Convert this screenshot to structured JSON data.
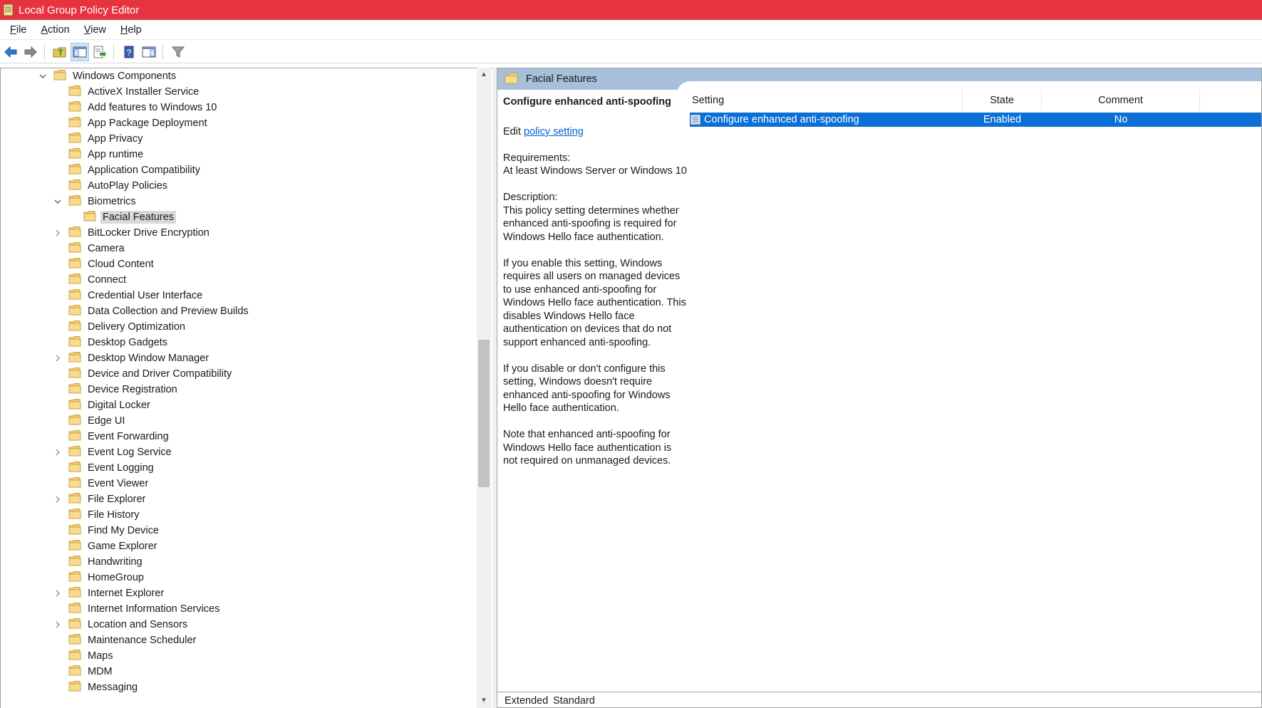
{
  "window": {
    "title": "Local Group Policy Editor",
    "accent": "#e5333f"
  },
  "menu": [
    {
      "label": "File",
      "mnemonic": "F",
      "rest": "ile"
    },
    {
      "label": "Action",
      "mnemonic": "A",
      "rest": "ction"
    },
    {
      "label": "View",
      "mnemonic": "V",
      "rest": "iew"
    },
    {
      "label": "Help",
      "mnemonic": "H",
      "rest": "elp"
    }
  ],
  "toolbar": {
    "icons": [
      "back-arrow-icon",
      "forward-arrow-icon",
      "up-folder-icon",
      "show-hide-tree-icon",
      "export-list-icon",
      "help-icon",
      "show-hide-action-pane-icon",
      "filter-icon"
    ]
  },
  "tree": [
    {
      "label": "Windows Components",
      "level": 0,
      "expander": "open"
    },
    {
      "label": "ActiveX Installer Service",
      "level": 1,
      "expander": "none"
    },
    {
      "label": "Add features to Windows 10",
      "level": 1,
      "expander": "none"
    },
    {
      "label": "App Package Deployment",
      "level": 1,
      "expander": "none"
    },
    {
      "label": "App Privacy",
      "level": 1,
      "expander": "none"
    },
    {
      "label": "App runtime",
      "level": 1,
      "expander": "none"
    },
    {
      "label": "Application Compatibility",
      "level": 1,
      "expander": "none"
    },
    {
      "label": "AutoPlay Policies",
      "level": 1,
      "expander": "none"
    },
    {
      "label": "Biometrics",
      "level": 1,
      "expander": "open"
    },
    {
      "label": "Facial Features",
      "level": 2,
      "expander": "none",
      "selected": true
    },
    {
      "label": "BitLocker Drive Encryption",
      "level": 1,
      "expander": "closed"
    },
    {
      "label": "Camera",
      "level": 1,
      "expander": "none"
    },
    {
      "label": "Cloud Content",
      "level": 1,
      "expander": "none"
    },
    {
      "label": "Connect",
      "level": 1,
      "expander": "none"
    },
    {
      "label": "Credential User Interface",
      "level": 1,
      "expander": "none"
    },
    {
      "label": "Data Collection and Preview Builds",
      "level": 1,
      "expander": "none"
    },
    {
      "label": "Delivery Optimization",
      "level": 1,
      "expander": "none"
    },
    {
      "label": "Desktop Gadgets",
      "level": 1,
      "expander": "none"
    },
    {
      "label": "Desktop Window Manager",
      "level": 1,
      "expander": "closed"
    },
    {
      "label": "Device and Driver Compatibility",
      "level": 1,
      "expander": "none"
    },
    {
      "label": "Device Registration",
      "level": 1,
      "expander": "none"
    },
    {
      "label": "Digital Locker",
      "level": 1,
      "expander": "none"
    },
    {
      "label": "Edge UI",
      "level": 1,
      "expander": "none"
    },
    {
      "label": "Event Forwarding",
      "level": 1,
      "expander": "none"
    },
    {
      "label": "Event Log Service",
      "level": 1,
      "expander": "closed"
    },
    {
      "label": "Event Logging",
      "level": 1,
      "expander": "none"
    },
    {
      "label": "Event Viewer",
      "level": 1,
      "expander": "none"
    },
    {
      "label": "File Explorer",
      "level": 1,
      "expander": "closed"
    },
    {
      "label": "File History",
      "level": 1,
      "expander": "none"
    },
    {
      "label": "Find My Device",
      "level": 1,
      "expander": "none"
    },
    {
      "label": "Game Explorer",
      "level": 1,
      "expander": "none"
    },
    {
      "label": "Handwriting",
      "level": 1,
      "expander": "none"
    },
    {
      "label": "HomeGroup",
      "level": 1,
      "expander": "none"
    },
    {
      "label": "Internet Explorer",
      "level": 1,
      "expander": "closed"
    },
    {
      "label": "Internet Information Services",
      "level": 1,
      "expander": "none"
    },
    {
      "label": "Location and Sensors",
      "level": 1,
      "expander": "closed"
    },
    {
      "label": "Maintenance Scheduler",
      "level": 1,
      "expander": "none"
    },
    {
      "label": "Maps",
      "level": 1,
      "expander": "none"
    },
    {
      "label": "MDM",
      "level": 1,
      "expander": "none"
    },
    {
      "label": "Messaging",
      "level": 1,
      "expander": "none"
    }
  ],
  "right": {
    "header_title": "Facial Features",
    "desc": {
      "title": "Configure enhanced anti-spoofing",
      "edit_prefix": "Edit ",
      "edit_link": "policy setting ",
      "requirements_label": "Requirements:",
      "requirements_text": "At least Windows Server or Windows 10",
      "description_label": "Description:",
      "paragraphs": [
        "This policy setting determines whether enhanced anti-spoofing is required for Windows Hello face authentication.",
        "If you enable this setting, Windows requires all users on managed devices to use enhanced anti-spoofing for Windows Hello face authentication. This disables Windows Hello face authentication on devices that do not support enhanced anti-spoofing.",
        "If you disable or don't configure this setting, Windows doesn't require enhanced anti-spoofing for Windows Hello face authentication.",
        "Note that enhanced anti-spoofing for Windows Hello face authentication is not required on unmanaged devices."
      ]
    },
    "columns": {
      "setting": "Setting",
      "state": "State",
      "comment": "Comment"
    },
    "rows": [
      {
        "setting": "Configure enhanced anti-spoofing",
        "state": "Enabled",
        "comment": "No"
      }
    ],
    "tabs": [
      "Extended",
      "Standard"
    ]
  }
}
